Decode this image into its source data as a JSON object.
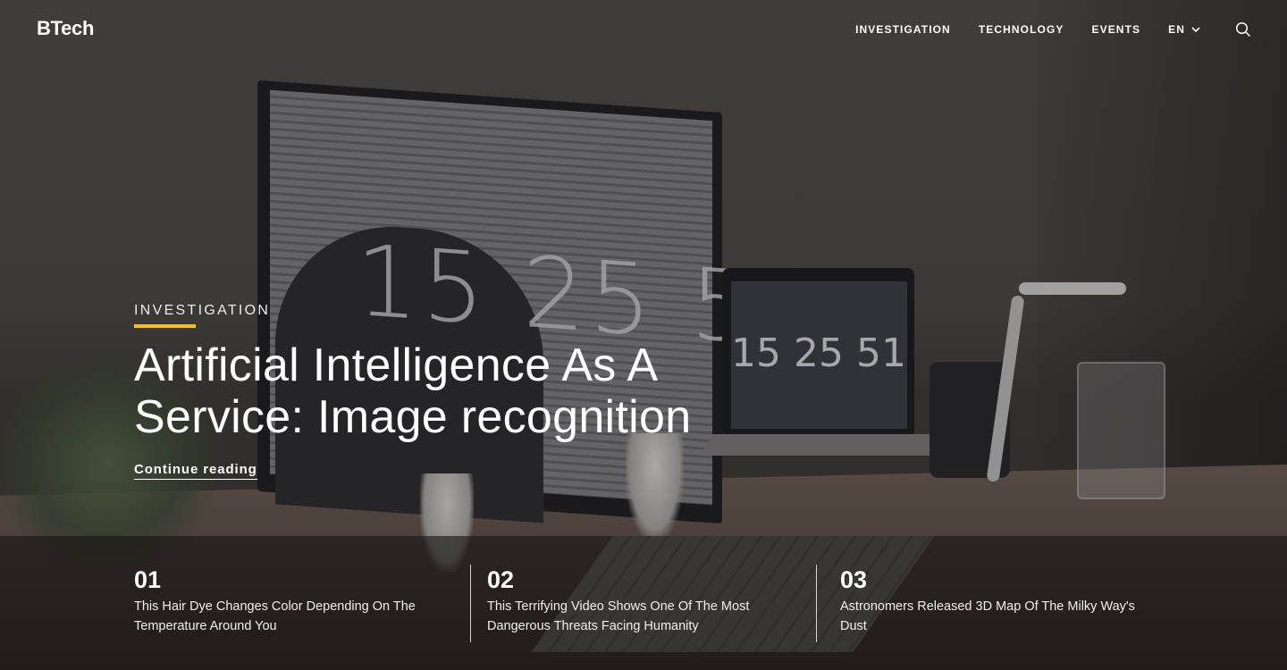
{
  "brand": {
    "logo": "BTech"
  },
  "nav": {
    "items": [
      "INVESTIGATION",
      "TECHNOLOGY",
      "EVENTS"
    ],
    "language": "EN",
    "icons": {
      "language_toggle": "chevron-down-icon",
      "search": "search-icon"
    }
  },
  "hero": {
    "category": "INVESTIGATION",
    "title_line1": "Artificial Intelligence As A",
    "title_line2": "Service: Image recognition",
    "link": "Continue reading",
    "accent_color": "#f2c511",
    "background_text": {
      "monitor_clock": "15 25 51",
      "laptop_clock": "15 25 51"
    }
  },
  "articles": [
    {
      "number": "01",
      "title": "This Hair Dye Changes Color Depending On The Temperature Around You"
    },
    {
      "number": "02",
      "title": "This Terrifying Video Shows One Of The Most Dangerous Threats Facing Humanity"
    },
    {
      "number": "03",
      "title": "Astronomers Released 3D Map Of The Milky Way's Dust"
    }
  ]
}
